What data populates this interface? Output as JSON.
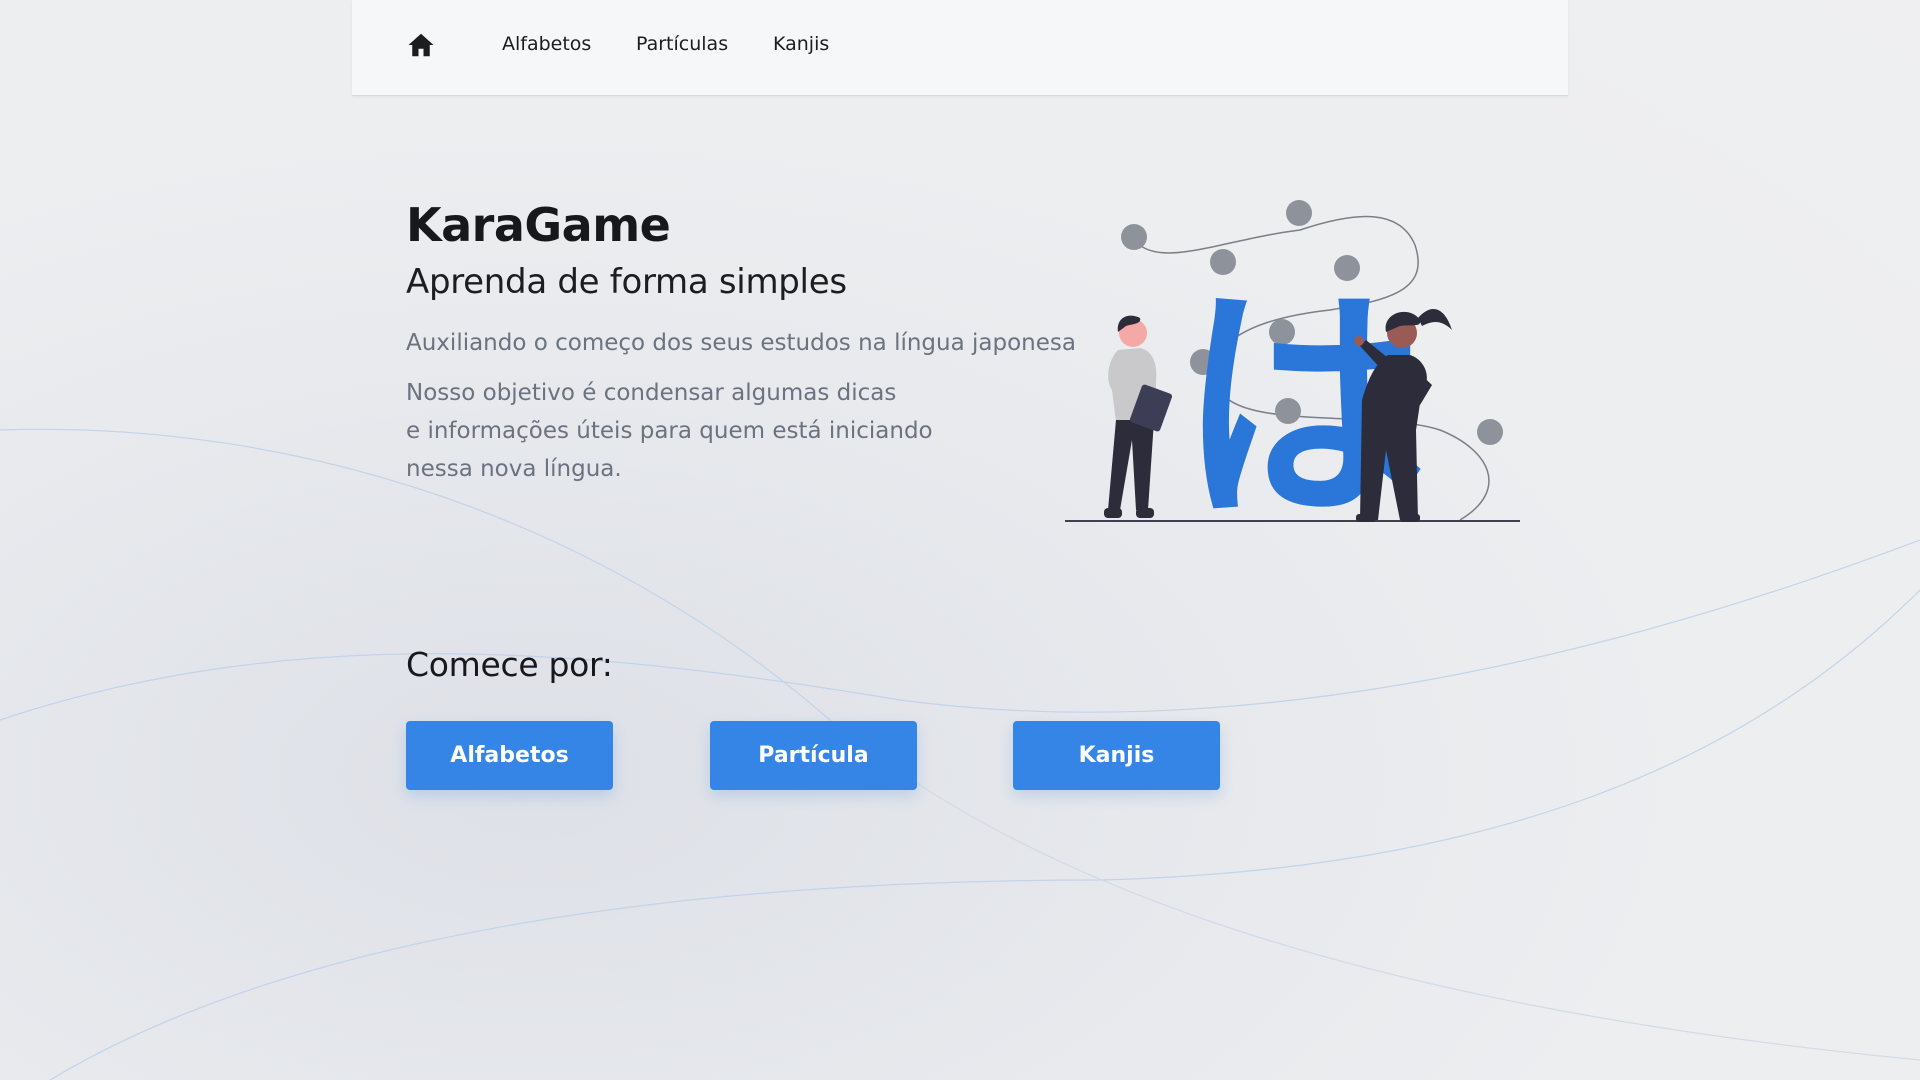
{
  "nav": {
    "home_icon": "home-icon",
    "links": [
      "Alfabetos",
      "Partículas",
      "Kanjis"
    ]
  },
  "hero": {
    "title": "KaraGame",
    "subtitle": "Aprenda de forma simples",
    "tagline": "Auxiliando o começo dos seus estudos na língua japonesa",
    "description_lines": [
      "Nosso objetivo é condensar algumas dicas",
      "e informações úteis para quem está iniciando",
      "nessa nova língua."
    ],
    "illustration_glyph": "は"
  },
  "start": {
    "heading": "Comece por:",
    "buttons": [
      "Alfabetos",
      "Partícula",
      "Kanjis"
    ]
  },
  "colors": {
    "accent": "#3585e6",
    "glyph": "#2a77d9",
    "text_primary": "#17181c",
    "text_muted": "#6b7280",
    "navbar_bg": "#f6f7f9"
  }
}
